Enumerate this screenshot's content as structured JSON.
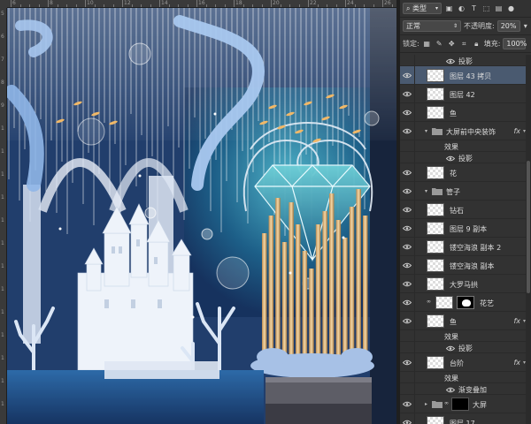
{
  "ruler_top": [
    "6",
    "8",
    "10",
    "12",
    "14",
    "16",
    "18",
    "20",
    "22",
    "24",
    "26"
  ],
  "ruler_left": [
    "5",
    "6",
    "7",
    "8",
    "9",
    "1",
    "1",
    "1",
    "1",
    "1",
    "1",
    "1",
    "1",
    "1",
    "1",
    "1",
    "1",
    "1"
  ],
  "panel": {
    "filter_kind": "类型",
    "blend_mode": "正常",
    "opacity_label": "不透明度:",
    "opacity_value": "20%",
    "lock_label": "锁定:",
    "fill_label": "填充:",
    "fill_value": "100%"
  },
  "layers": [
    {
      "name": "投影",
      "kind": "effect-item"
    },
    {
      "name": "图层 43 拷贝",
      "kind": "layer",
      "selected": true
    },
    {
      "name": "图层 42",
      "kind": "layer"
    },
    {
      "name": "鱼",
      "kind": "layer"
    },
    {
      "name": "大屏前中央装饰",
      "kind": "folder",
      "fx": "fx"
    },
    {
      "name": "效果",
      "kind": "effects-header"
    },
    {
      "name": "投影",
      "kind": "effect-item"
    },
    {
      "name": "花",
      "kind": "layer"
    },
    {
      "name": "管子",
      "kind": "folder"
    },
    {
      "name": "钻石",
      "kind": "layer"
    },
    {
      "name": "图层 9 副本",
      "kind": "layer"
    },
    {
      "name": "镂空海浪 副本 2",
      "kind": "layer"
    },
    {
      "name": "镂空海浪 副本",
      "kind": "layer"
    },
    {
      "name": "大罗马拱",
      "kind": "layer"
    },
    {
      "name": "花艺",
      "kind": "masked"
    },
    {
      "name": "鱼",
      "kind": "layer",
      "fx": "fx"
    },
    {
      "name": "效果",
      "kind": "effects-header"
    },
    {
      "name": "投影",
      "kind": "effect-item"
    },
    {
      "name": "台阶",
      "kind": "layer",
      "fx": "fx"
    },
    {
      "name": "效果",
      "kind": "effects-header"
    },
    {
      "name": "渐变叠加",
      "kind": "effect-item"
    },
    {
      "name": "大屏",
      "kind": "folder-mask"
    },
    {
      "name": "图层 17",
      "kind": "layer"
    }
  ]
}
